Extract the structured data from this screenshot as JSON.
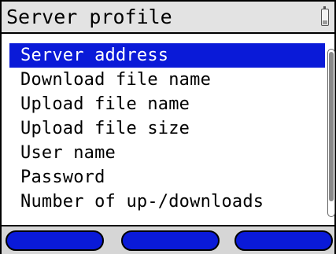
{
  "title": "Server profile",
  "status_icons": {
    "battery": "battery-icon"
  },
  "menu": {
    "items": [
      {
        "label": "Server address",
        "selected": true
      },
      {
        "label": "Download file name",
        "selected": false
      },
      {
        "label": "Upload file name",
        "selected": false
      },
      {
        "label": "Upload file size",
        "selected": false
      },
      {
        "label": "User name",
        "selected": false
      },
      {
        "label": "Password",
        "selected": false
      },
      {
        "label": "Number of up-/downloads",
        "selected": false
      }
    ]
  },
  "softkeys": [
    {
      "label": ""
    },
    {
      "label": ""
    },
    {
      "label": ""
    }
  ],
  "colors": {
    "selection": "#0a1ad8",
    "softkey": "#0a1ad8",
    "titlebar": "#e3e3e3",
    "softkey_bar": "#d6d6d6"
  }
}
